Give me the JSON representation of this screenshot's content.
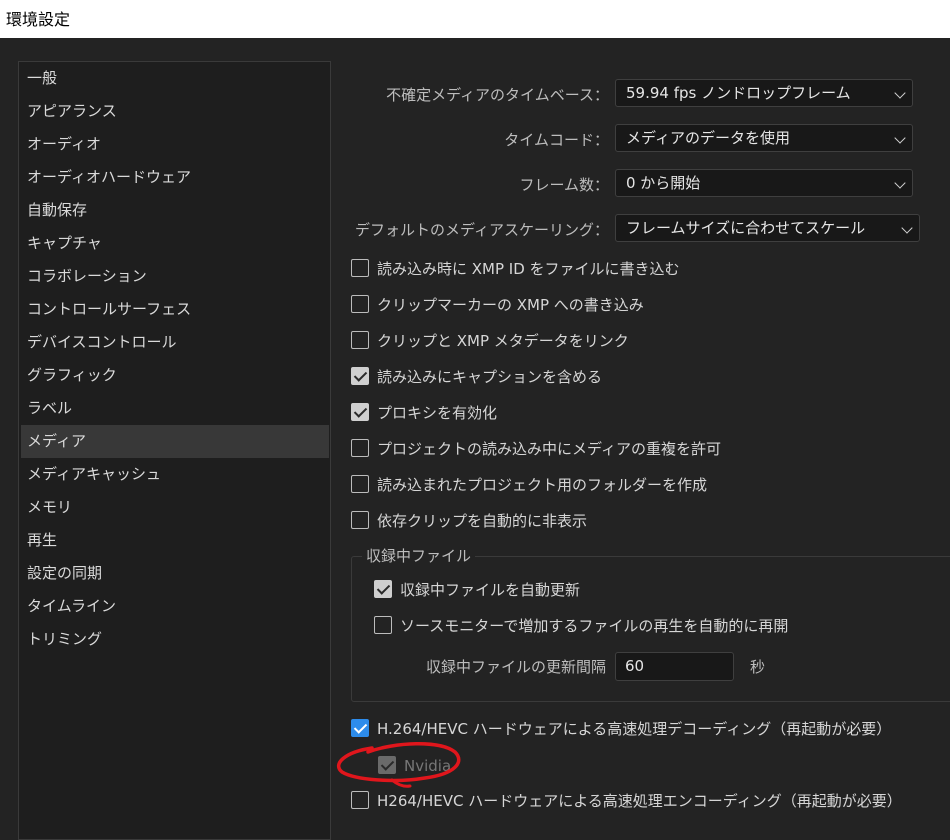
{
  "window": {
    "title": "環境設定"
  },
  "sidebar": {
    "items": [
      "一般",
      "アピアランス",
      "オーディオ",
      "オーディオハードウェア",
      "自動保存",
      "キャプチャ",
      "コラボレーション",
      "コントロールサーフェス",
      "デバイスコントロール",
      "グラフィック",
      "ラベル",
      "メディア",
      "メディアキャッシュ",
      "メモリ",
      "再生",
      "設定の同期",
      "タイムライン",
      "トリミング"
    ],
    "selected": "メディア"
  },
  "media": {
    "timebase": {
      "label": "不確定メディアのタイムベース：",
      "value": "59.94  fps  ノンドロップフレーム"
    },
    "timecode": {
      "label": "タイムコード：",
      "value": "メディアのデータを使用"
    },
    "frame_count": {
      "label": "フレーム数：",
      "value": "0 から開始"
    },
    "scaling": {
      "label": "デフォルトのメディアスケーリング：",
      "value": "フレームサイズに合わせてスケール"
    },
    "checkboxes": [
      {
        "label": "読み込み時に XMP ID をファイルに書き込む",
        "checked": false
      },
      {
        "label": "クリップマーカーの XMP への書き込み",
        "checked": false
      },
      {
        "label": "クリップと XMP メタデータをリンク",
        "checked": false
      },
      {
        "label": "読み込みにキャプションを含める",
        "checked": true
      },
      {
        "label": "プロキシを有効化",
        "checked": true
      },
      {
        "label": "プロジェクトの読み込み中にメディアの重複を許可",
        "checked": false
      },
      {
        "label": "読み込まれたプロジェクト用のフォルダーを作成",
        "checked": false
      },
      {
        "label": "依存クリップを自動的に非表示",
        "checked": false
      }
    ],
    "growing_files": {
      "title": "収録中ファイル",
      "auto_refresh": {
        "label": "収録中ファイルを自動更新",
        "checked": true
      },
      "auto_resume": {
        "label": "ソースモニターで増加するファイルの再生を自動的に再開",
        "checked": false
      },
      "interval": {
        "label": "収録中ファイルの更新間隔",
        "value": "60",
        "unit": "秒"
      }
    },
    "hw_decode": {
      "label": "H.264/HEVC ハードウェアによる高速処理デコーディング（再起動が必要）",
      "checked": true
    },
    "nvidia": {
      "label": "Nvidia",
      "checked": true,
      "disabled": true
    },
    "hw_encode": {
      "label": "H264/HEVC ハードウェアによる高速処理エンコーディング（再起動が必要）",
      "checked": false
    }
  },
  "colors": {
    "annotation": "#e0161c",
    "accent": "#2d8ceb"
  }
}
